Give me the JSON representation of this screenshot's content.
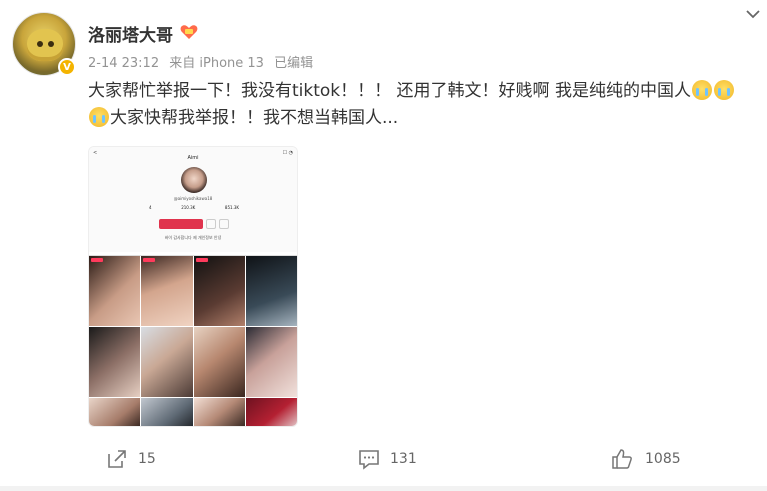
{
  "post": {
    "username": "洛丽塔大哥",
    "meta": {
      "date": "2-14 23:12",
      "source": "来自 iPhone 13",
      "edited": "已编辑"
    },
    "text_line1": "大家帮忙举报一下！我没有tiktok！！！ 还用了韩文！好贱啊 我是纯纯的中国人",
    "text_line2": "大家快帮我举报！！我不想当韩国人..."
  },
  "screenshot": {
    "profile_name": "Aimi",
    "handle": "@aimiyoshikawa18",
    "stats": [
      "4",
      "210.3K",
      "851.3K"
    ],
    "bio": "바이 감사합니다 제 개인정보 안녕"
  },
  "actions": {
    "repost_count": "15",
    "comment_count": "131",
    "like_count": "1085"
  },
  "icons": {
    "avatar": "avatar",
    "verified": "verified-badge-icon",
    "vip": "vip-heart-icon",
    "more": "chevron-down-icon",
    "crying_emoji": "crying-emoji-icon",
    "repost": "repost-icon",
    "comment": "comment-icon",
    "like": "thumbs-up-icon"
  },
  "colors": {
    "accent": "#f4b400",
    "text": "#333333",
    "meta": "#939393",
    "action": "#666666"
  }
}
